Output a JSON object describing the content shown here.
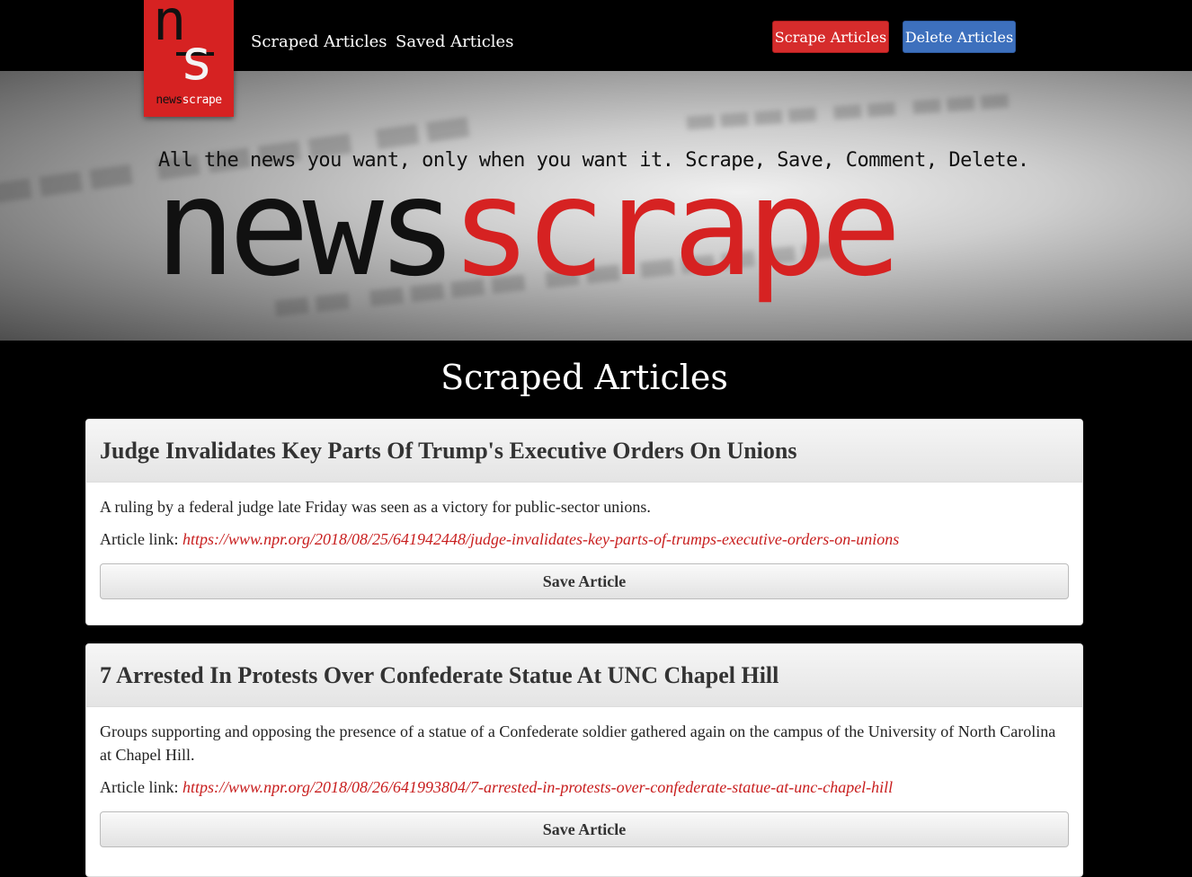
{
  "nav": {
    "logo_letter_n": "n",
    "logo_letter_s": "s",
    "logo_word_1": "news",
    "logo_word_2": "scrape",
    "links": [
      "Scraped Articles",
      "Saved Articles"
    ],
    "scrape_button": "Scrape Articles",
    "delete_button": "Delete Articles"
  },
  "hero": {
    "tagline": "All the news you want, only when you want it. Scrape, Save, Comment, Delete.",
    "title_part_1": "news",
    "title_part_2": "scrape"
  },
  "main": {
    "heading": "Scraped Articles",
    "link_prefix": "Article link:",
    "save_label": "Save Article",
    "articles": [
      {
        "title": "Judge Invalidates Key Parts Of Trump's Executive Orders On Unions",
        "summary": "A ruling by a federal judge late Friday was seen as a victory for public-sector unions.",
        "url": "https://www.npr.org/2018/08/25/641942448/judge-invalidates-key-parts-of-trumps-executive-orders-on-unions"
      },
      {
        "title": "7 Arrested In Protests Over Confederate Statue At UNC Chapel Hill",
        "summary": "Groups supporting and opposing the presence of a statue of a Confederate soldier gathered again on the campus of the University of North Carolina at Chapel Hill.",
        "url": "https://www.npr.org/2018/08/26/641993804/7-arrested-in-protests-over-confederate-statue-at-unc-chapel-hill"
      }
    ]
  },
  "colors": {
    "brand_red": "#d62222",
    "delete_blue": "#3d70bd"
  }
}
